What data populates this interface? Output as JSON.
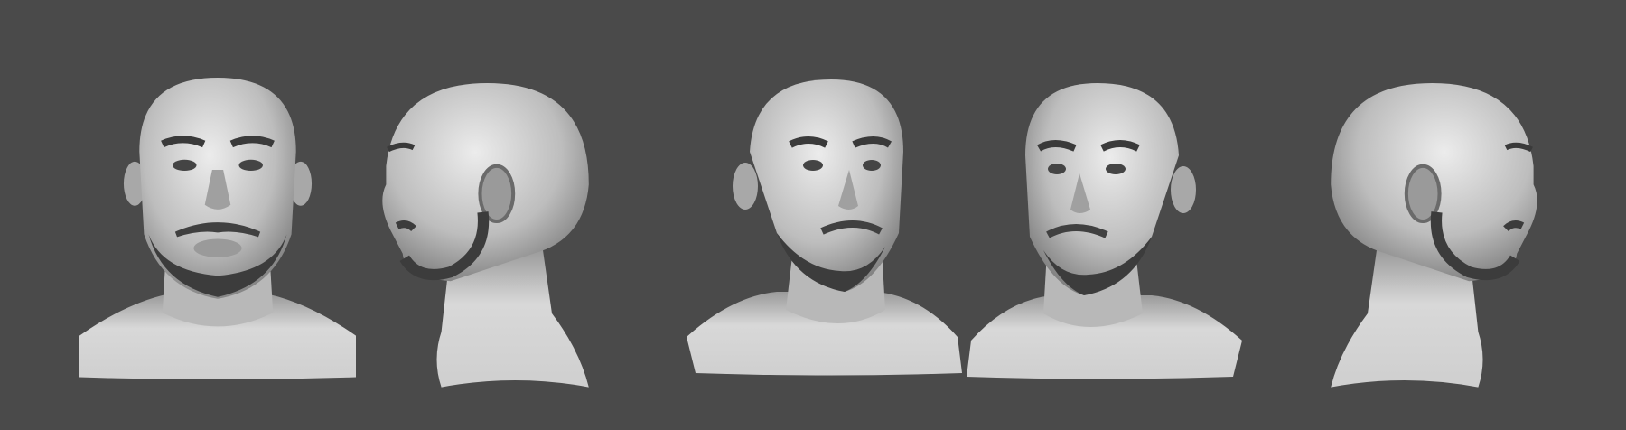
{
  "colors": {
    "background": "#4a4a4a",
    "skin_light": "#e6e6e6",
    "skin_mid": "#b4b4b4",
    "skin_dark": "#6e6e6e",
    "hair": "#3a3a3a"
  },
  "views": [
    {
      "kind": "front",
      "mirror": false
    },
    {
      "kind": "profile",
      "mirror": false
    },
    {
      "kind": "three-quarter",
      "mirror": false
    },
    {
      "kind": "three-quarter",
      "mirror": true
    },
    {
      "kind": "profile",
      "mirror": true
    }
  ]
}
